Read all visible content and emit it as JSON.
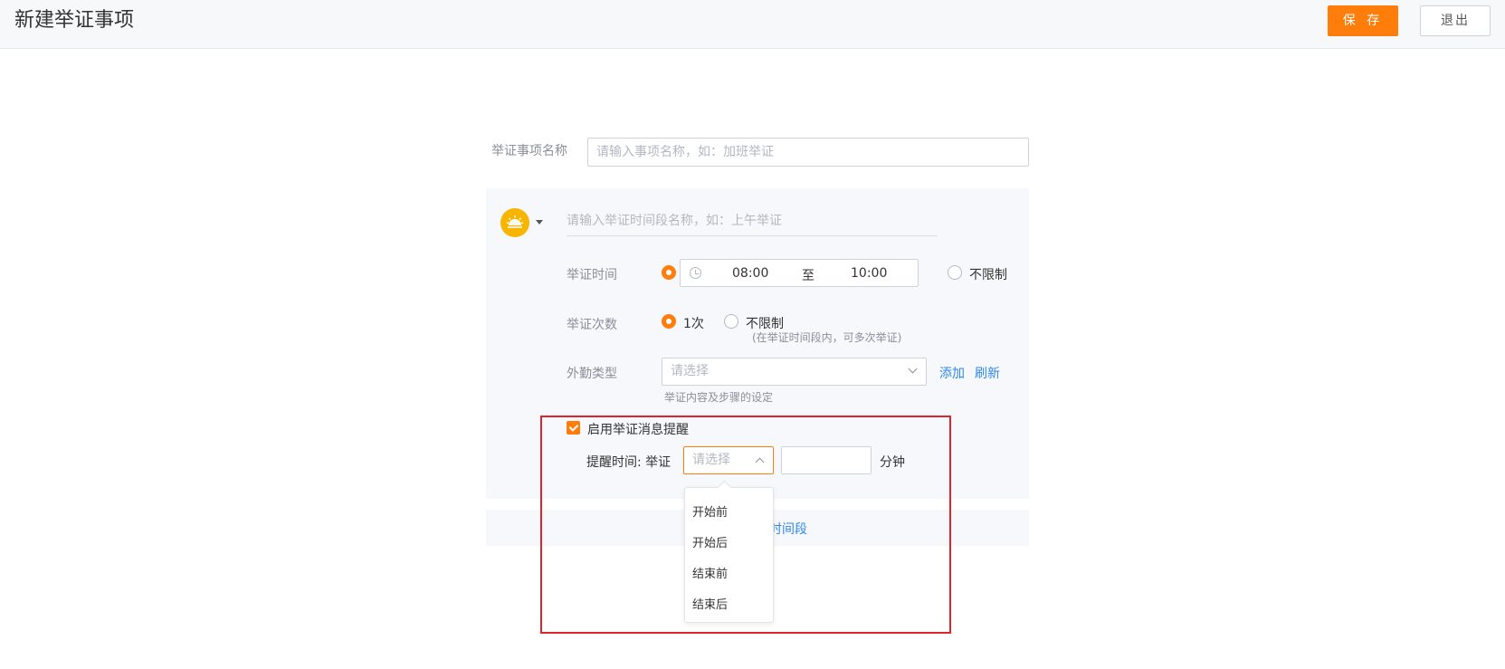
{
  "header": {
    "title": "新建举证事项",
    "save_label": "保 存",
    "exit_label": "退出"
  },
  "name_field": {
    "label": "举证事项名称",
    "placeholder": "请输入事项名称，如：加班举证"
  },
  "segment": {
    "name_placeholder": "请输入举证时间段名称，如：上午举证",
    "time": {
      "label": "举证时间",
      "start": "08:00",
      "to": "至",
      "end": "10:00",
      "unlimited_label": "不限制",
      "selected": "range"
    },
    "count": {
      "label": "举证次数",
      "once_label": "1次",
      "unlimited_label": "不限制",
      "unlimited_hint": "(在举证时间段内，可多次举证)",
      "selected": "once"
    },
    "field_type": {
      "label": "外勤类型",
      "placeholder": "请选择",
      "add_label": "添加",
      "refresh_label": "刷新",
      "hint": "举证内容及步骤的设定"
    },
    "reminder": {
      "enabled": true,
      "checkbox_label": "启用举证消息提醒",
      "time_label": "提醒时间: 举证",
      "select_placeholder": "请选择",
      "minutes_value": "",
      "unit": "分钟",
      "options": [
        "开始前",
        "开始后",
        "结束前",
        "结束后"
      ]
    }
  },
  "add_segment_label": "时间段",
  "colors": {
    "accent": "#ff7d0a",
    "link": "#2f88ea",
    "highlight": "#e0242e"
  }
}
